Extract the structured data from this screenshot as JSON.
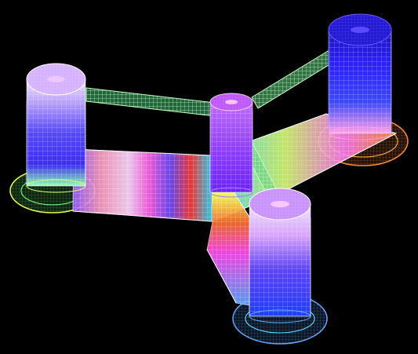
{
  "scene": {
    "background_color": "#000000",
    "render_style": "wireframe mesh",
    "palette": {
      "column_top": "#d8b0ff",
      "column_mid": "#5a45ff",
      "column_dark": "#1d16aa",
      "brace": "#b8ffb3",
      "deck_yellow": "#f4ff50",
      "deck_cyan": "#45e2ff",
      "deck_orange": "#ff8b2e",
      "deck_magenta": "#ff4bf2",
      "deck_green": "#4cff57",
      "deck_red": "#ff3a3a",
      "deck_white": "#f8f3ff",
      "heave_plate_blue": "#52a4ff"
    }
  }
}
